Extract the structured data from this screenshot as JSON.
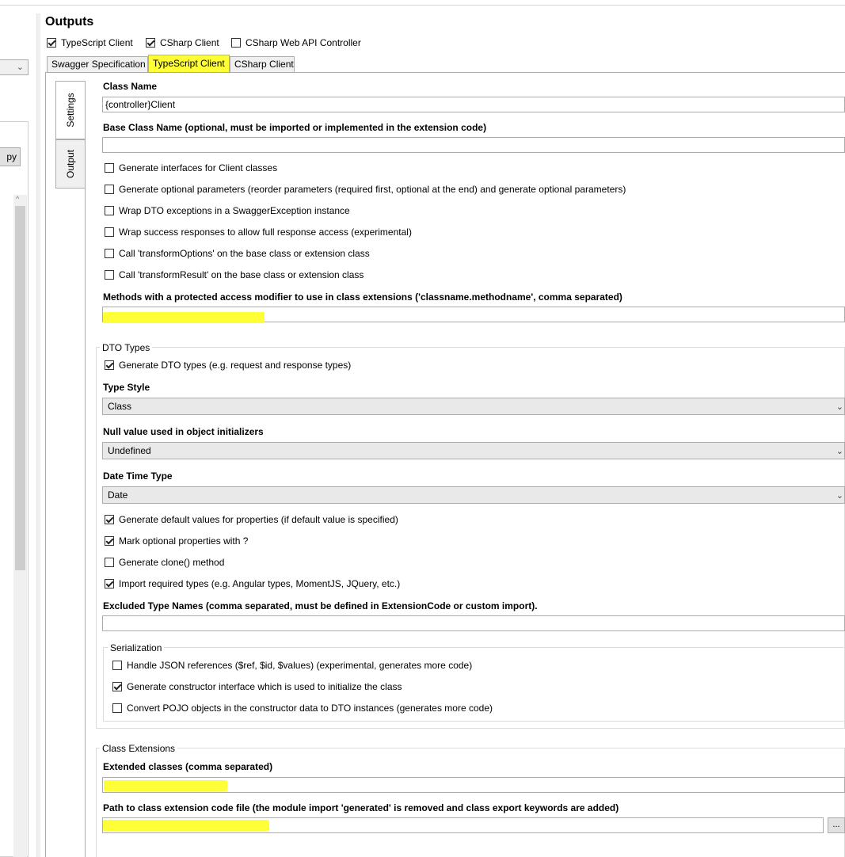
{
  "left": {
    "copy_label": "py",
    "scroll_up": "^"
  },
  "outputs": {
    "title": "Outputs",
    "checkboxes": [
      {
        "label": "TypeScript Client",
        "checked": true
      },
      {
        "label": "CSharp Client",
        "checked": true
      },
      {
        "label": "CSharp Web API Controller",
        "checked": false
      }
    ]
  },
  "tabs": [
    {
      "label": "Swagger Specification",
      "active": false
    },
    {
      "label": "TypeScript Client",
      "active": true
    },
    {
      "label": "CSharp Client",
      "active": false
    }
  ],
  "vtabs": [
    {
      "label": "Settings",
      "active": true
    },
    {
      "label": "Output",
      "active": false
    }
  ],
  "settings": {
    "class_name_label": "Class Name",
    "class_name_value": "{controller}Client",
    "base_class_label": "Base Class Name (optional, must be imported or implemented in the extension code)",
    "base_class_value": "",
    "options": [
      {
        "label": "Generate interfaces for Client classes",
        "checked": false
      },
      {
        "label": "Generate optional parameters (reorder parameters (required first, optional at the end) and generate optional parameters)",
        "checked": false
      },
      {
        "label": "Wrap DTO exceptions in a SwaggerException instance",
        "checked": false
      },
      {
        "label": "Wrap success responses to allow full response access (experimental)",
        "checked": false
      },
      {
        "label": "Call 'transformOptions' on the base class or extension class",
        "checked": false
      },
      {
        "label": "Call 'transformResult' on the base class or extension class",
        "checked": false
      }
    ],
    "protected_methods_label": "Methods with a protected access modifier to use in class extensions ('classname.methodname', comma separated)",
    "protected_methods_value": ""
  },
  "dto": {
    "group_title": "DTO Types",
    "generate_dto": {
      "label": "Generate DTO types (e.g. request and response types)",
      "checked": true
    },
    "type_style_label": "Type Style",
    "type_style_value": "Class",
    "null_value_label": "Null value used in object initializers",
    "null_value_value": "Undefined",
    "date_time_label": "Date Time Type",
    "date_time_value": "Date",
    "options": [
      {
        "label": "Generate default values for properties (if default value is specified)",
        "checked": true
      },
      {
        "label": "Mark optional properties with ?",
        "checked": true
      },
      {
        "label": "Generate clone() method",
        "checked": false
      },
      {
        "label": "Import required types (e.g. Angular types, MomentJS, JQuery, etc.)",
        "checked": true
      }
    ],
    "excluded_label": "Excluded Type Names (comma separated, must be defined in ExtensionCode or custom import).",
    "excluded_value": "",
    "serialization": {
      "title": "Serialization",
      "options": [
        {
          "label": "Handle JSON references ($ref, $id, $values) (experimental, generates more code)",
          "checked": false
        },
        {
          "label": "Generate constructor interface which is used to initialize the class",
          "checked": true
        },
        {
          "label": "Convert POJO objects in the constructor data to DTO instances (generates more code)",
          "checked": false
        }
      ]
    }
  },
  "class_extensions": {
    "group_title": "Class Extensions",
    "extended_label": "Extended classes (comma separated)",
    "extended_value": "",
    "path_label": "Path to class extension code file (the module import 'generated' is removed and class export keywords are added)",
    "path_value": "",
    "browse_label": "..."
  },
  "colors": {
    "highlight": "#ffff38",
    "tab_bg": "#f0f0f0",
    "border": "#acacac"
  }
}
